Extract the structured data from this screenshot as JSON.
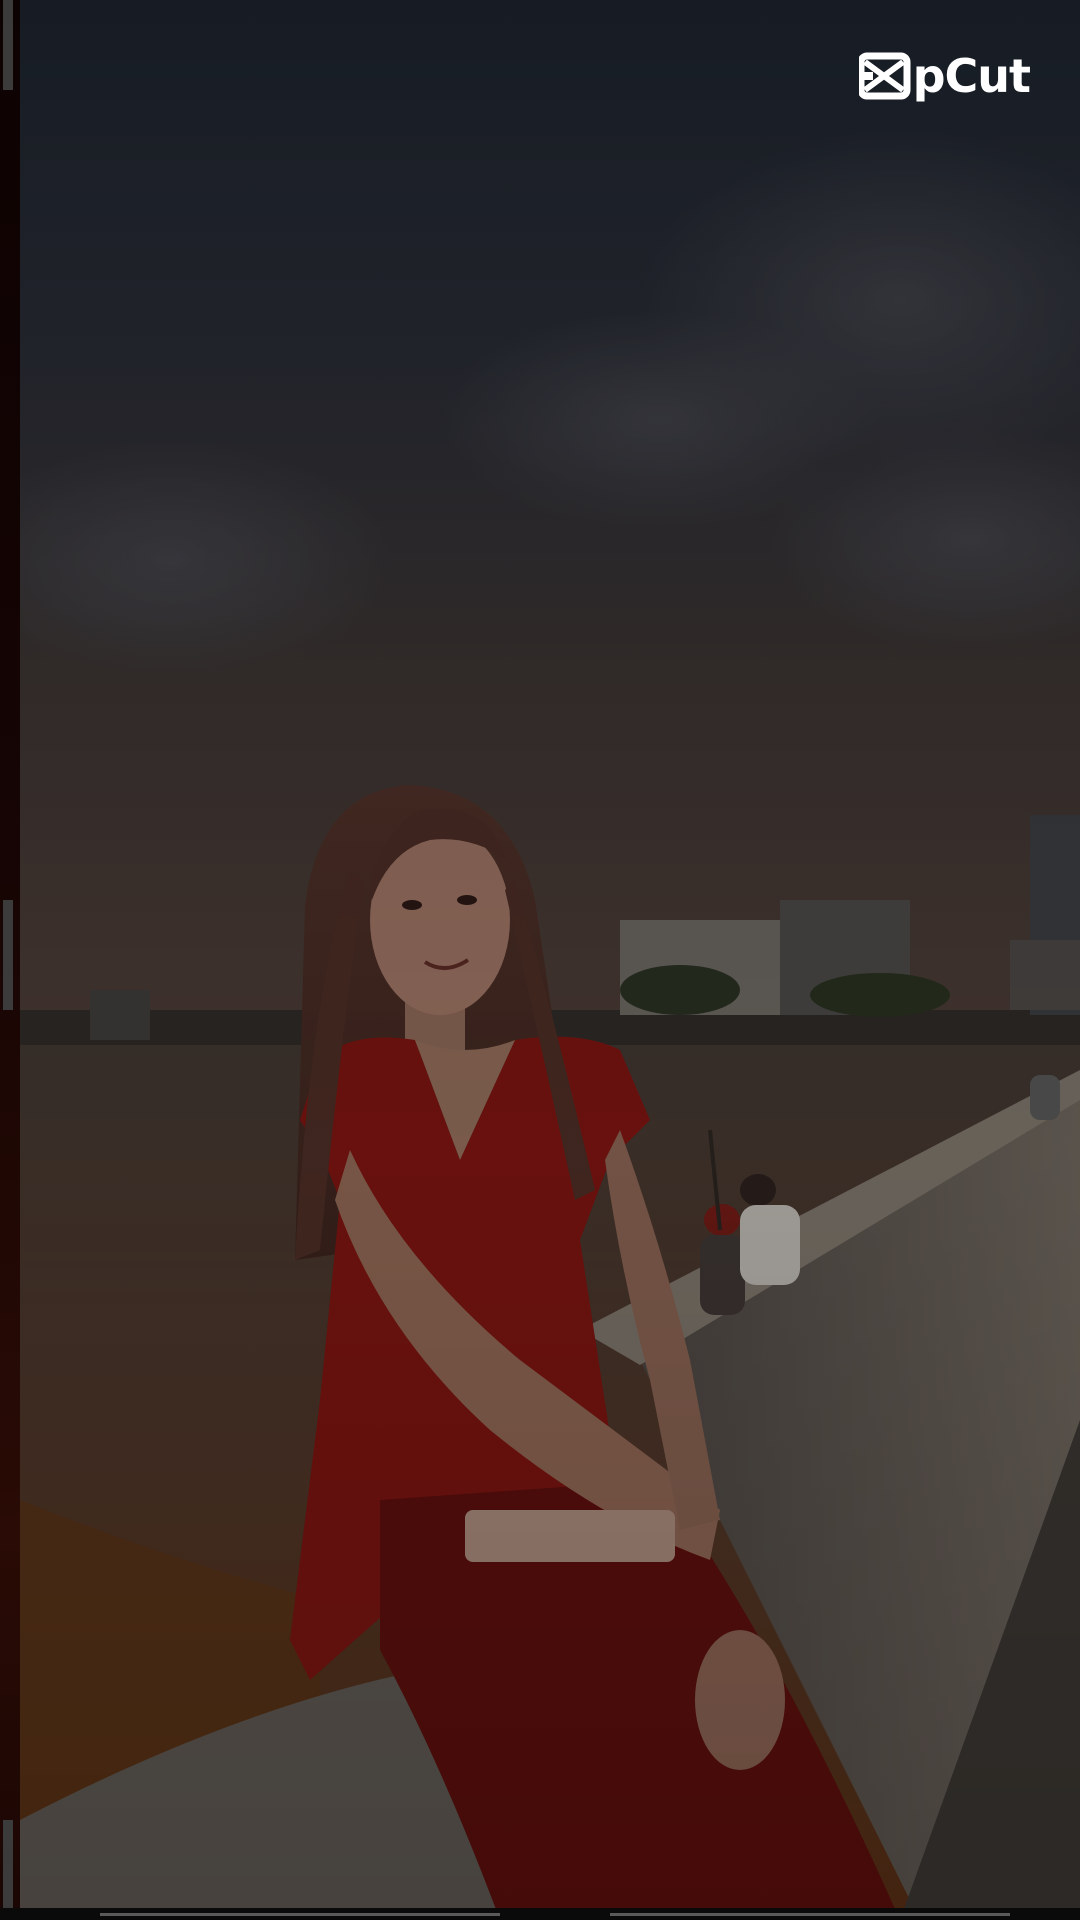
{
  "watermark": {
    "logo_icon": "capcut-logo-icon",
    "text": "pCut"
  },
  "colors": {
    "sky": "#2b2e36",
    "dress": "#7a1512",
    "water": "#4a3a32",
    "wall": "#5c5650",
    "overlay_dim": "rgba(0,0,0,0.45)"
  }
}
